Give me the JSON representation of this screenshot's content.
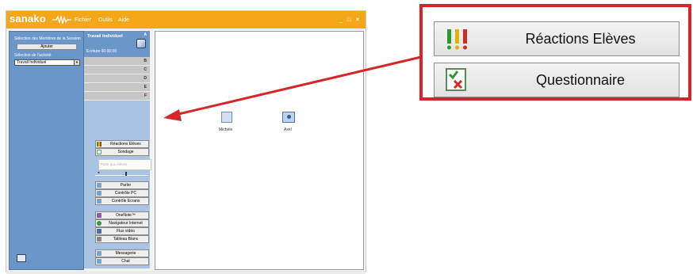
{
  "app": {
    "brand": "sanako",
    "menu": [
      "Fichier",
      "Outils",
      "Aide"
    ]
  },
  "left_panel": {
    "members_label": "Sélection des Membres de la Session",
    "add_button": "Ajouter",
    "activity_label": "Sélection de l'activité",
    "activity_value": "Travail Individuel"
  },
  "mid_panel": {
    "title": "Travail Individuel",
    "slot_a": "A",
    "timer_label": "Ecriture",
    "timer_value": "00:00:00",
    "slots": [
      "B",
      "C",
      "D",
      "E",
      "F"
    ],
    "note_placeholder": "Parle aux élèves",
    "buttons": [
      "Réactions Elèves",
      "Sondage",
      "Parler",
      "Contrôle PC",
      "Contrôle Ecrans",
      "OneNote™",
      "Navigateur Internet",
      "Flux vidéo",
      "Tableau Blanc",
      "Messagerie",
      "Chat"
    ]
  },
  "workarea": {
    "students": [
      "Michèle",
      "Axel"
    ]
  },
  "callout": {
    "buttons": [
      "Réactions Elèves",
      "Questionnaire"
    ]
  },
  "colors": {
    "titlebar": "#f4a718",
    "panel_blue": "#6a96c9",
    "callout_border": "#d6262b",
    "arrow": "#d6262b"
  }
}
